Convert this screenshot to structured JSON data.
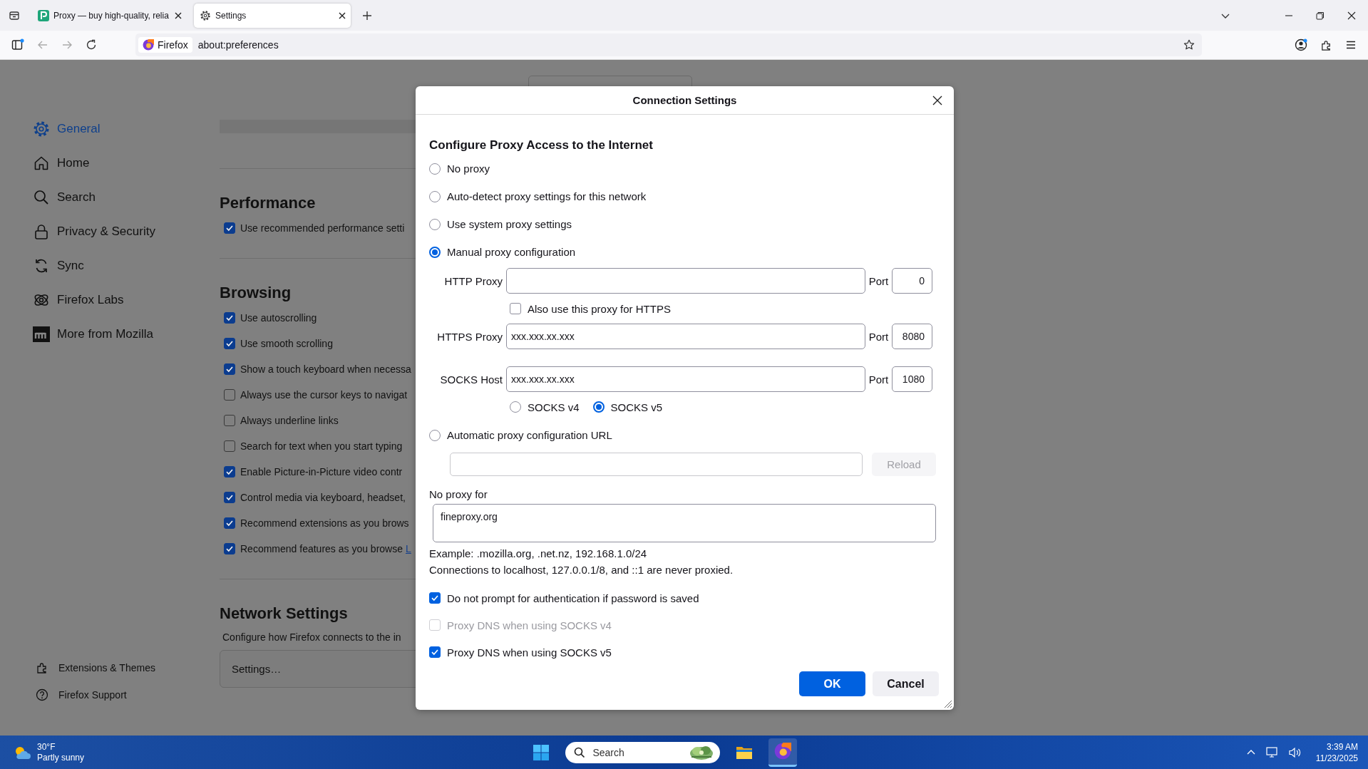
{
  "browser": {
    "tabs": [
      {
        "title": "Proxy — buy high-quality, relia",
        "selected": false
      },
      {
        "title": "Settings",
        "selected": true
      }
    ],
    "identity": "Firefox",
    "url": "about:preferences"
  },
  "sidebar": {
    "items": [
      {
        "label": "General",
        "selected": true
      },
      {
        "label": "Home",
        "selected": false
      },
      {
        "label": "Search",
        "selected": false
      },
      {
        "label": "Privacy & Security",
        "selected": false
      },
      {
        "label": "Sync",
        "selected": false
      },
      {
        "label": "Firefox Labs",
        "selected": false
      },
      {
        "label": "More from Mozilla",
        "selected": false
      }
    ],
    "footer": [
      "Extensions & Themes",
      "Firefox Support"
    ]
  },
  "content": {
    "sections": [
      {
        "heading": "Performance",
        "rows": [
          {
            "label": "Use recommended performance setti",
            "checked": true
          }
        ]
      },
      {
        "heading": "Browsing",
        "rows": [
          {
            "label": "Use autoscrolling",
            "checked": true
          },
          {
            "label": "Use smooth scrolling",
            "checked": true
          },
          {
            "label": "Show a touch keyboard when necessa",
            "checked": true
          },
          {
            "label": "Always use the cursor keys to navigat",
            "checked": false
          },
          {
            "label": "Always underline links",
            "checked": false
          },
          {
            "label": "Search for text when you start typing",
            "checked": false
          },
          {
            "label": "Enable Picture-in-Picture video contr",
            "checked": true
          },
          {
            "label": "Control media via keyboard, headset,",
            "checked": true
          },
          {
            "label": "Recommend extensions as you brows",
            "checked": true
          },
          {
            "label": "Recommend features as you browse",
            "link": "L",
            "checked": true
          }
        ]
      },
      {
        "heading": "Network Settings",
        "description": "Configure how Firefox connects to the in",
        "button": "Settings…"
      }
    ]
  },
  "dialog": {
    "title": "Connection Settings",
    "heading": "Configure Proxy Access to the Internet",
    "modes": [
      {
        "label": "No proxy",
        "selected": false
      },
      {
        "label": "Auto-detect proxy settings for this network",
        "selected": false
      },
      {
        "label": "Use system proxy settings",
        "selected": false
      },
      {
        "label": "Manual proxy configuration",
        "selected": true
      },
      {
        "label": "Automatic proxy configuration URL",
        "selected": false
      }
    ],
    "proxies": [
      {
        "label": "HTTP Proxy",
        "port_label": "Port",
        "port": "0"
      },
      {
        "label": "HTTPS Proxy",
        "value": "xxx.xxx.xx.xxx",
        "port_label": "Port",
        "port": "8080"
      },
      {
        "label": "SOCKS Host",
        "value": "xxx.xxx.xx.xxx",
        "port_label": "Port",
        "port": "1080"
      }
    ],
    "also_https": {
      "label": "Also use this proxy for HTTPS",
      "checked": false
    },
    "socks_versions": [
      {
        "label": "SOCKS v4",
        "selected": false
      },
      {
        "label": "SOCKS v5",
        "selected": true
      }
    ],
    "reload": {
      "label": "Reload",
      "disabled": true
    },
    "no_proxy": {
      "label": "No proxy for",
      "value": "fineproxy.org"
    },
    "notes": [
      "Example: .mozilla.org, .net.nz, 192.168.1.0/24",
      "Connections to localhost, 127.0.0.1/8, and ::1 are never proxied."
    ],
    "options": [
      {
        "label": "Do not prompt for authentication if password is saved",
        "checked": true,
        "disabled": false
      },
      {
        "label": "Proxy DNS when using SOCKS v4",
        "checked": false,
        "disabled": true
      },
      {
        "label": "Proxy DNS when using SOCKS v5",
        "checked": true,
        "disabled": false
      }
    ],
    "buttons": [
      {
        "label": "OK",
        "kind": "primary"
      },
      {
        "label": "Cancel",
        "kind": "secondary"
      }
    ]
  },
  "taskbar": {
    "weather": {
      "temp": "30°F",
      "condition": "Partly sunny"
    },
    "search": {
      "placeholder": "Search"
    },
    "apps": [
      {
        "active": false
      },
      {
        "active": true
      }
    ],
    "clock": {
      "time": "3:39 AM",
      "date": "11/23/2025"
    }
  }
}
